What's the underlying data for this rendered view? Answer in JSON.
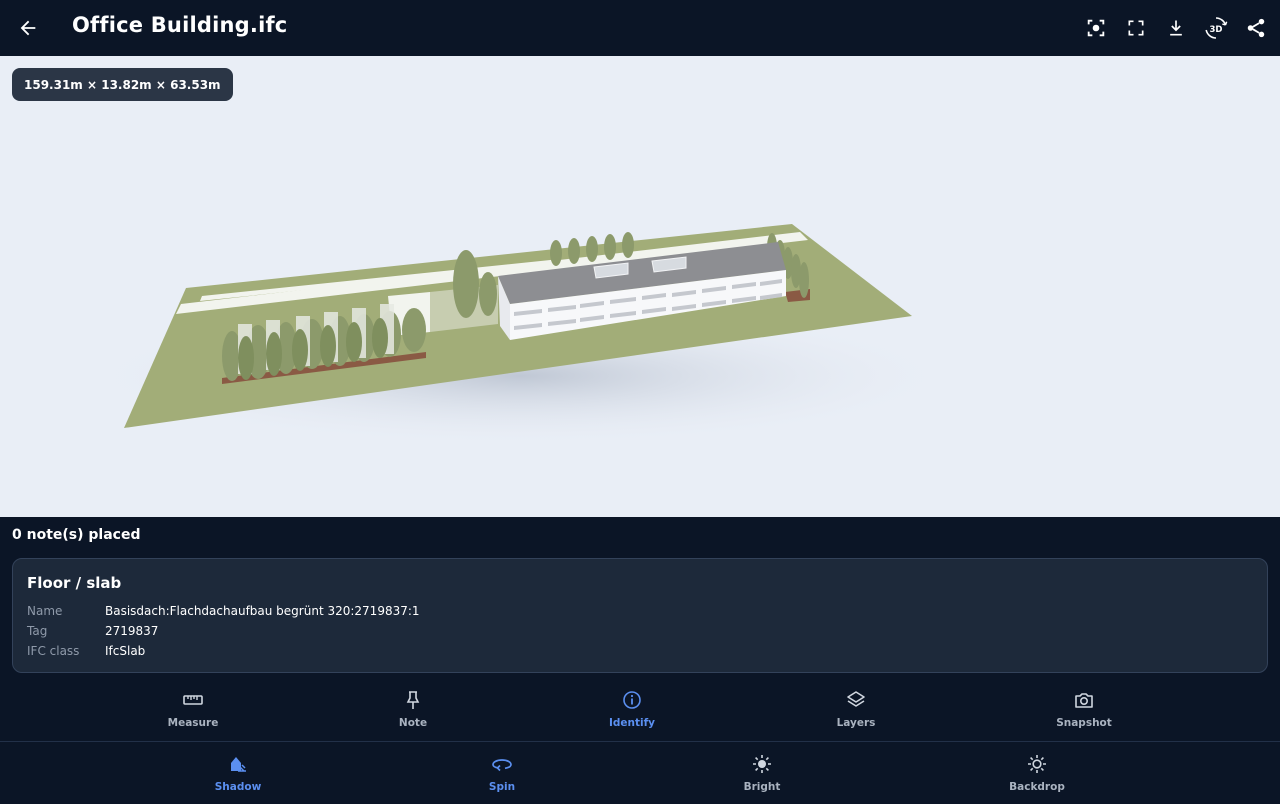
{
  "header": {
    "title": "Office Building.ifc"
  },
  "viewport": {
    "dimensions_badge": "159.31m × 13.82m × 63.53m"
  },
  "notes": {
    "status": "0 note(s) placed"
  },
  "info": {
    "title": "Floor / slab",
    "rows": [
      {
        "key": "Name",
        "value": "Basisdach:Flachdachaufbau begrünt 320:2719837:1"
      },
      {
        "key": "Tag",
        "value": "2719837"
      },
      {
        "key": "IFC class",
        "value": "IfcSlab"
      }
    ]
  },
  "tools": [
    {
      "label": "Measure",
      "icon": "ruler-icon",
      "active": false
    },
    {
      "label": "Note",
      "icon": "pin-icon",
      "active": false
    },
    {
      "label": "Identify",
      "icon": "info-icon",
      "active": true
    },
    {
      "label": "Layers",
      "icon": "layers-icon",
      "active": false
    },
    {
      "label": "Snapshot",
      "icon": "camera-icon",
      "active": false
    }
  ],
  "display": [
    {
      "label": "Shadow",
      "icon": "shadow-icon",
      "active": true
    },
    {
      "label": "Spin",
      "icon": "spin-icon",
      "active": true
    },
    {
      "label": "Bright",
      "icon": "sun-icon",
      "active": false
    },
    {
      "label": "Backdrop",
      "icon": "backdrop-icon",
      "active": false
    }
  ],
  "colors": {
    "background": "#0b1526",
    "viewport": "#e9eef6",
    "card": "#1d293a",
    "accent": "#5b8ff0",
    "ground": "#a2ad78"
  }
}
